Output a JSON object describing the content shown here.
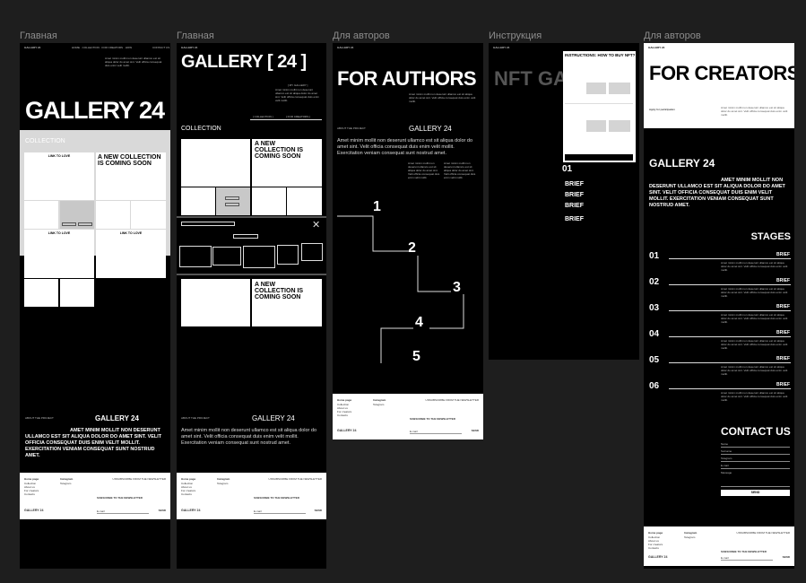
{
  "canvas": {
    "background": "#1e1e1e",
    "accent_gray": "#d9d9d9"
  },
  "frames": [
    {
      "label": "Главная",
      "logo": "GALLERY 24",
      "hero": "GALLERY 24",
      "nav": "HOME · COLLECTION · FOR CREATORS · HOW",
      "contact": "CONTACT US",
      "section": "COLLECTION",
      "link_card": "LINK TO LOVE",
      "new_collection": "A NEW COLLECTION IS COMING SOON",
      "about_label": "ABOUT THE PROJECT",
      "about_title": "GALLERY 24",
      "about_text": "AMET MINIM MOLLIT NON DESERUNT ULLAMCO EST SIT ALIQUA DOLOR DO AMET SINT. VELIT OFFICIA CONSEQUAT DUIS ENIM VELIT MOLLIT. EXERCITATION VENIAM CONSEQUAT SUNT NOSTRUD AMET."
    },
    {
      "label": "Главная",
      "logo": "GALLERY 24",
      "hero": "GALLERY  [ 24 ]",
      "my_gallery": "[ MY GALLERY ]",
      "section": "COLLECTION",
      "new_collection": "A NEW COLLECTION IS COMING SOON",
      "link_1": "[ COLLECTION ]",
      "link_2": "[ FOR CREATORS ]",
      "about_label": "ABOUT THE PROJECT",
      "about_title": "GALLERY 24",
      "about_text": "Amet minim mollit non deserunt ullamco est sit aliqua dolor do amet sint. Velit officia consequat duis enim velit mollit. Exercitation veniam consequat sunt nostrud amet."
    },
    {
      "label": "Для авторов",
      "logo": "GALLERY 24",
      "hero": "FOR AUTHORS",
      "about_label": "ABOUT THE PROJECT",
      "about_title": "GALLERY 24",
      "about_text": "Amet minim mollit non deserunt ullamco est sit aliqua dolor do amet sint. Velit officia consequat duis enim velit mollit. Exercitation veniam consequat sunt nostrud amet.",
      "steps": [
        "1",
        "2",
        "3",
        "4",
        "5"
      ]
    },
    {
      "label": "Инструкция",
      "logo": "GALLERY 24",
      "hero": "NFT GA",
      "panel_title": "INSTRUCTIONS: HOW TO BUY NFT?",
      "number": "01",
      "briefs": [
        "BRIEF",
        "BRIEF",
        "BRIEF",
        "BRIEF"
      ]
    },
    {
      "label": "Для авторов",
      "logo": "GALLERY 24",
      "hero": "FOR CREATORS",
      "apply": "Apply for participation",
      "about_title": "GALLERY 24",
      "about_text": "AMET MINIM MOLLIT NON DESERUNT ULLAMCO EST SIT ALIQUA DOLOR DO AMET SINT. VELIT OFFICIA CONSEQUAT DUIS ENIM VELIT MOLLIT. EXERCITATION VENIAM CONSEQUAT SUNT NOSTRUD AMET.",
      "stages_title": "STAGES",
      "stages": [
        {
          "num": "01",
          "title": "BRIEF"
        },
        {
          "num": "02",
          "title": "BRIEF"
        },
        {
          "num": "03",
          "title": "BRIEF"
        },
        {
          "num": "04",
          "title": "BRIEF"
        },
        {
          "num": "05",
          "title": "BRIEF"
        },
        {
          "num": "06",
          "title": "BRIEF"
        }
      ],
      "contact_title": "CONTACT US",
      "fields": [
        "Name",
        "Surname",
        "Telegram",
        "E-mail",
        "Message"
      ],
      "send": "SEND"
    }
  ],
  "lorem": "Amet minim mollit non deserunt ullamco est sit aliqua dolor do amet sint. Velit officia consequat duis enim velit mollit.",
  "footer": {
    "col1_title": "Home page",
    "col1_items": [
      "Collection",
      "About us",
      "For creators",
      "Contacts"
    ],
    "col2_title": "Instagram",
    "col2_items": [
      "Telegram"
    ],
    "right": "UNSUBSCRIBE FROM THE NEWSLETTER",
    "subscribe": "SUBSCRIBE TO THE NEWSLETTER",
    "logo": "GALLERY 24",
    "email_placeholder": "E-mail",
    "send": "SEND"
  }
}
